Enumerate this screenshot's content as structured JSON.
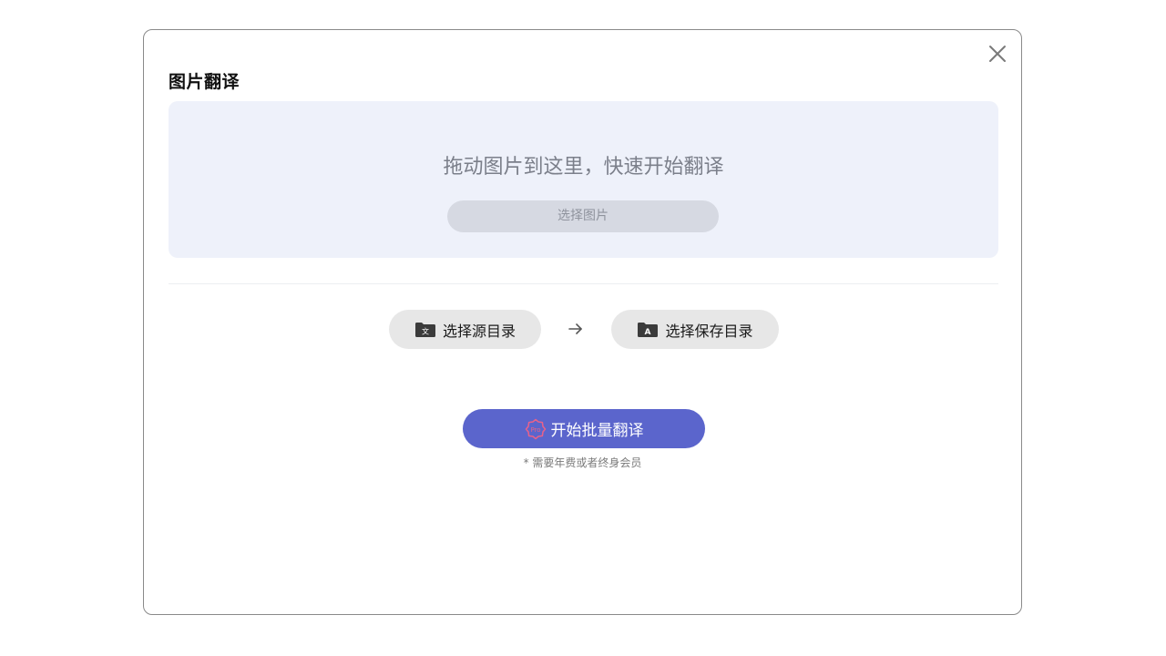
{
  "dialog": {
    "title": "图片翻译",
    "close_icon": "close-icon"
  },
  "dropzone": {
    "hint": "拖动图片到这里，快速开始翻译",
    "pick_label": "选择图片"
  },
  "directories": {
    "source_label": "选择源目录",
    "source_icon": "folder-text-icon",
    "source_icon_glyph": "文",
    "target_label": "选择保存目录",
    "target_icon": "folder-a-icon",
    "target_icon_glyph": "A",
    "arrow_icon": "arrow-right-icon"
  },
  "batch": {
    "start_label": "开始批量翻译",
    "badge_icon": "pro-badge-icon",
    "badge_text": "Pro",
    "note": "* 需要年费或者终身会员"
  },
  "colors": {
    "primary": "#5b65cc",
    "dropzone_bg": "#eef1fa",
    "pro_badge": "#e8628a"
  }
}
